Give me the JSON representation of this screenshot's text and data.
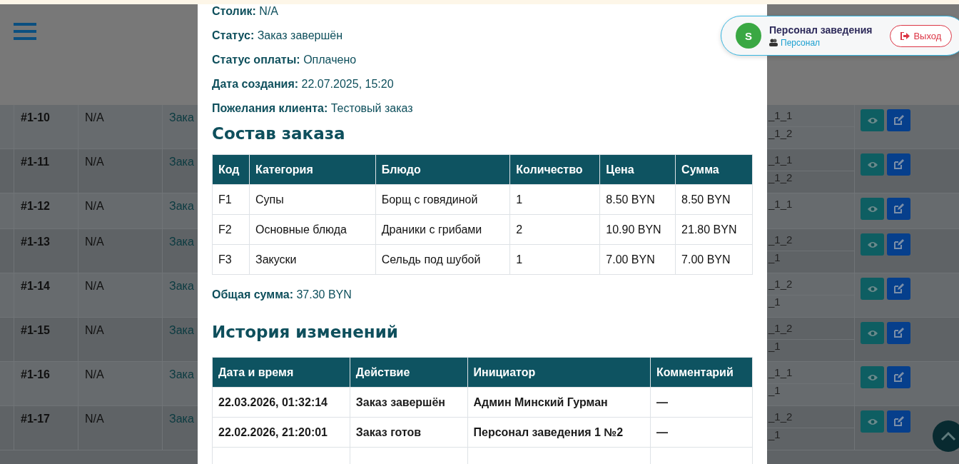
{
  "page": {
    "rows": [
      {
        "id": "#1-10",
        "table": "N/A",
        "status": "Зака",
        "items": [
          "_1_1",
          "_1_2"
        ]
      },
      {
        "id": "#1-11",
        "table": "N/A",
        "status": "Зака",
        "items": [
          "_1_1",
          "_1_2"
        ]
      },
      {
        "id": "#1-12",
        "table": "N/A",
        "status": "Зака",
        "items": [
          "_1_1"
        ]
      },
      {
        "id": "#1-13",
        "table": "N/A",
        "status": "Зака",
        "items": [
          "_1_2",
          "_1"
        ]
      },
      {
        "id": "#1-14",
        "table": "N/A",
        "status": "Зака",
        "items": [
          "_1_2",
          "_1"
        ]
      },
      {
        "id": "#1-15",
        "table": "N/A",
        "status": "Зака",
        "items": [
          "_1_2",
          "_1"
        ]
      },
      {
        "id": "#1-16",
        "table": "N/A",
        "status": "Зака",
        "items": [
          "_1_1",
          "_1"
        ]
      },
      {
        "id": "#1-17",
        "table": "N/A",
        "status": "Зака",
        "items": [
          "_1_2",
          "_1"
        ]
      }
    ]
  },
  "user": {
    "avatar": "S",
    "name": "Персонал заведения",
    "role": "Персонал",
    "logout": "Выход"
  },
  "modal": {
    "fields": [
      {
        "label": "Столик:",
        "value": "N/A"
      },
      {
        "label": "Статус:",
        "value": "Заказ завершён"
      },
      {
        "label": "Статус оплаты:",
        "value": "Оплачено"
      },
      {
        "label": "Дата создания:",
        "value": "22.07.2025, 15:20"
      },
      {
        "label": "Пожелания клиента:",
        "value": "Тестовый заказ"
      }
    ],
    "items_title": "Состав заказа",
    "items_columns": [
      "Код",
      "Категория",
      "Блюдо",
      "Количество",
      "Цена",
      "Сумма"
    ],
    "items_rows": [
      [
        "F1",
        "Супы",
        "Борщ с говядиной",
        "1",
        "8.50 BYN",
        "8.50 BYN"
      ],
      [
        "F2",
        "Основные блюда",
        "Драники с грибами",
        "2",
        "10.90 BYN",
        "21.80 BYN"
      ],
      [
        "F3",
        "Закуски",
        "Сельдь под шубой",
        "1",
        "7.00 BYN",
        "7.00 BYN"
      ]
    ],
    "total": {
      "label": "Общая сумма:",
      "value": "37.30 BYN"
    },
    "history_title": "История изменений",
    "history_columns": [
      "Дата и время",
      "Действие",
      "Инициатор",
      "Комментарий"
    ],
    "history_rows": [
      [
        "22.03.2026, 01:32:14",
        "Заказ завершён",
        "Админ Минский Гурман",
        "—"
      ],
      [
        "22.02.2026, 21:20:01",
        "Заказ готов",
        "Персонал заведения 1 №2",
        "—"
      ]
    ]
  }
}
